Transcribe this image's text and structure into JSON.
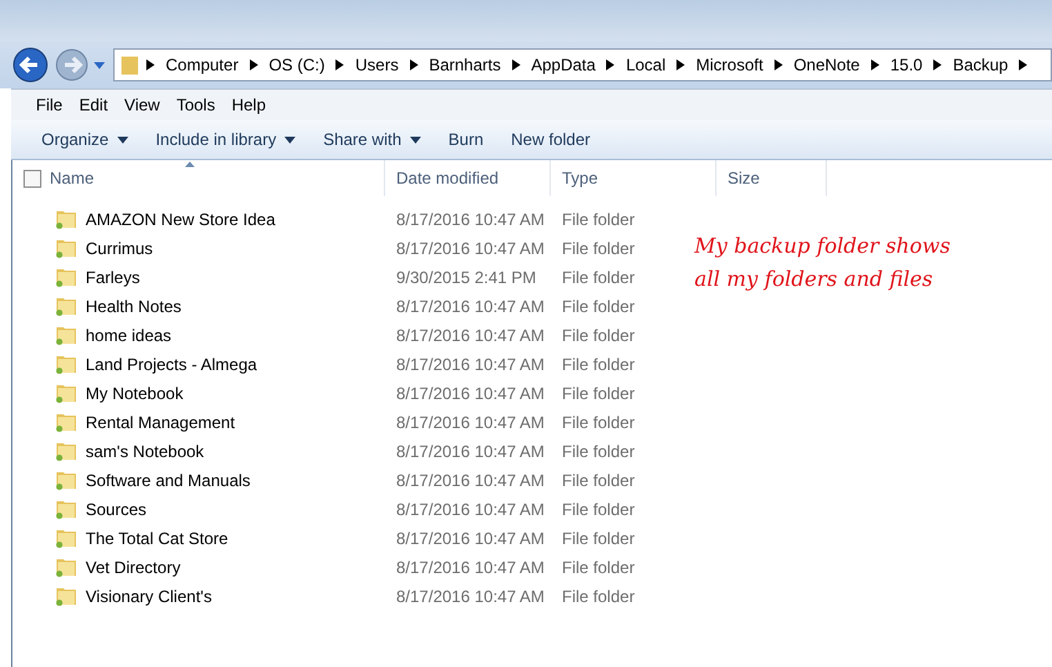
{
  "breadcrumb": [
    "Computer",
    "OS (C:)",
    "Users",
    "Barnharts",
    "AppData",
    "Local",
    "Microsoft",
    "OneNote",
    "15.0",
    "Backup"
  ],
  "menu": [
    "File",
    "Edit",
    "View",
    "Tools",
    "Help"
  ],
  "toolbar": [
    {
      "label": "Organize",
      "dropdown": true
    },
    {
      "label": "Include in library",
      "dropdown": true
    },
    {
      "label": "Share with",
      "dropdown": true
    },
    {
      "label": "Burn",
      "dropdown": false
    },
    {
      "label": "New folder",
      "dropdown": false
    }
  ],
  "columns": [
    {
      "label": "Name",
      "sorted": true
    },
    {
      "label": "Date modified",
      "sorted": false
    },
    {
      "label": "Type",
      "sorted": false
    },
    {
      "label": "Size",
      "sorted": false
    }
  ],
  "select_all": {
    "checked": false
  },
  "rows": [
    {
      "name": "AMAZON New Store Idea",
      "date": "8/17/2016 10:47 AM",
      "type": "File folder"
    },
    {
      "name": "Currimus",
      "date": "8/17/2016 10:47 AM",
      "type": "File folder"
    },
    {
      "name": "Farleys",
      "date": "9/30/2015 2:41 PM",
      "type": "File folder"
    },
    {
      "name": "Health Notes",
      "date": "8/17/2016 10:47 AM",
      "type": "File folder"
    },
    {
      "name": "home ideas",
      "date": "8/17/2016 10:47 AM",
      "type": "File folder"
    },
    {
      "name": "Land Projects - Almega",
      "date": "8/17/2016 10:47 AM",
      "type": "File folder"
    },
    {
      "name": "My Notebook",
      "date": "8/17/2016 10:47 AM",
      "type": "File folder"
    },
    {
      "name": "Rental Management",
      "date": "8/17/2016 10:47 AM",
      "type": "File folder"
    },
    {
      "name": "sam's Notebook",
      "date": "8/17/2016 10:47 AM",
      "type": "File folder"
    },
    {
      "name": "Software and Manuals",
      "date": "8/17/2016 10:47 AM",
      "type": "File folder"
    },
    {
      "name": "Sources",
      "date": "8/17/2016 10:47 AM",
      "type": "File folder"
    },
    {
      "name": "The Total Cat Store",
      "date": "8/17/2016 10:47 AM",
      "type": "File folder"
    },
    {
      "name": "Vet Directory",
      "date": "8/17/2016 10:47 AM",
      "type": "File folder"
    },
    {
      "name": "Visionary Client's",
      "date": "8/17/2016 10:47 AM",
      "type": "File folder"
    }
  ],
  "annotation": [
    "My backup folder shows",
    "all my folders and files"
  ]
}
